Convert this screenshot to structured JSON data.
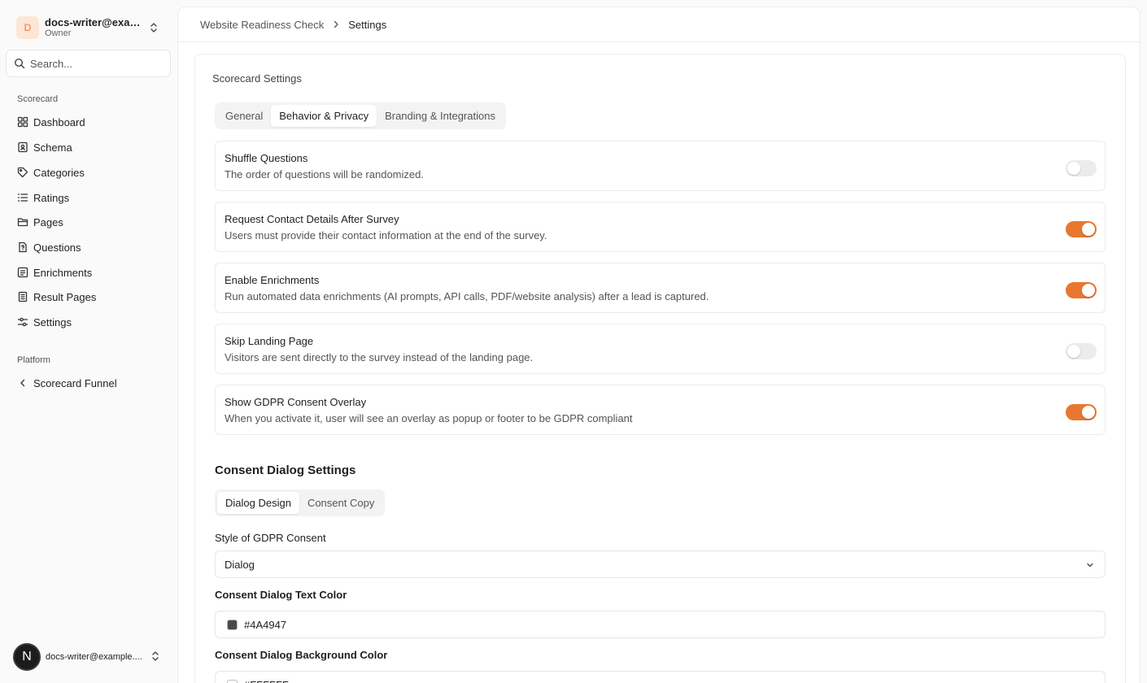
{
  "account": {
    "initial": "D",
    "name": "docs-writer@exam...",
    "role": "Owner"
  },
  "search": {
    "placeholder": "Search..."
  },
  "sidebar": {
    "group1_label": "Scorecard",
    "items": [
      {
        "label": "Dashboard",
        "icon": "dashboard-icon"
      },
      {
        "label": "Schema",
        "icon": "schema-icon"
      },
      {
        "label": "Categories",
        "icon": "tag-icon"
      },
      {
        "label": "Ratings",
        "icon": "list-icon"
      },
      {
        "label": "Pages",
        "icon": "folder-icon"
      },
      {
        "label": "Questions",
        "icon": "question-file-icon"
      },
      {
        "label": "Enrichments",
        "icon": "enrichments-icon"
      },
      {
        "label": "Result Pages",
        "icon": "result-pages-icon"
      },
      {
        "label": "Settings",
        "icon": "settings-sliders-icon"
      }
    ],
    "group2_label": "Platform",
    "platform_items": [
      {
        "label": "Scorecard Funnel",
        "icon": "chevron-left-icon"
      }
    ]
  },
  "user": {
    "initial": "N",
    "email": "docs-writer@example...."
  },
  "breadcrumb": {
    "parent": "Website Readiness Check",
    "current": "Settings"
  },
  "card": {
    "title": "Scorecard Settings",
    "tabs": [
      "General",
      "Behavior & Privacy",
      "Branding & Integrations"
    ],
    "active_tab": "Behavior & Privacy"
  },
  "settings": [
    {
      "title": "Shuffle Questions",
      "description": "The order of questions will be randomized.",
      "enabled": false
    },
    {
      "title": "Request Contact Details After Survey",
      "description": "Users must provide their contact information at the end of the survey.",
      "enabled": true
    },
    {
      "title": "Enable Enrichments",
      "description": "Run automated data enrichments (AI prompts, API calls, PDF/website analysis) after a lead is captured.",
      "enabled": true
    },
    {
      "title": "Skip Landing Page",
      "description": "Visitors are sent directly to the survey instead of the landing page.",
      "enabled": false
    },
    {
      "title": "Show GDPR Consent Overlay",
      "description": "When you activate it, user will see an overlay as popup or footer to be GDPR compliant",
      "enabled": true
    }
  ],
  "consent": {
    "title": "Consent Dialog Settings",
    "tabs": [
      "Dialog Design",
      "Consent Copy"
    ],
    "active_tab": "Dialog Design",
    "style_label": "Style of GDPR Consent",
    "style_value": "Dialog",
    "text_color_label": "Consent Dialog Text Color",
    "text_color": "#4A4947",
    "bg_color_label": "Consent Dialog Background Color",
    "bg_color": "#FFFFFF"
  },
  "colors": {
    "accent": "#e8782f",
    "toggle_off": "#ececec"
  }
}
